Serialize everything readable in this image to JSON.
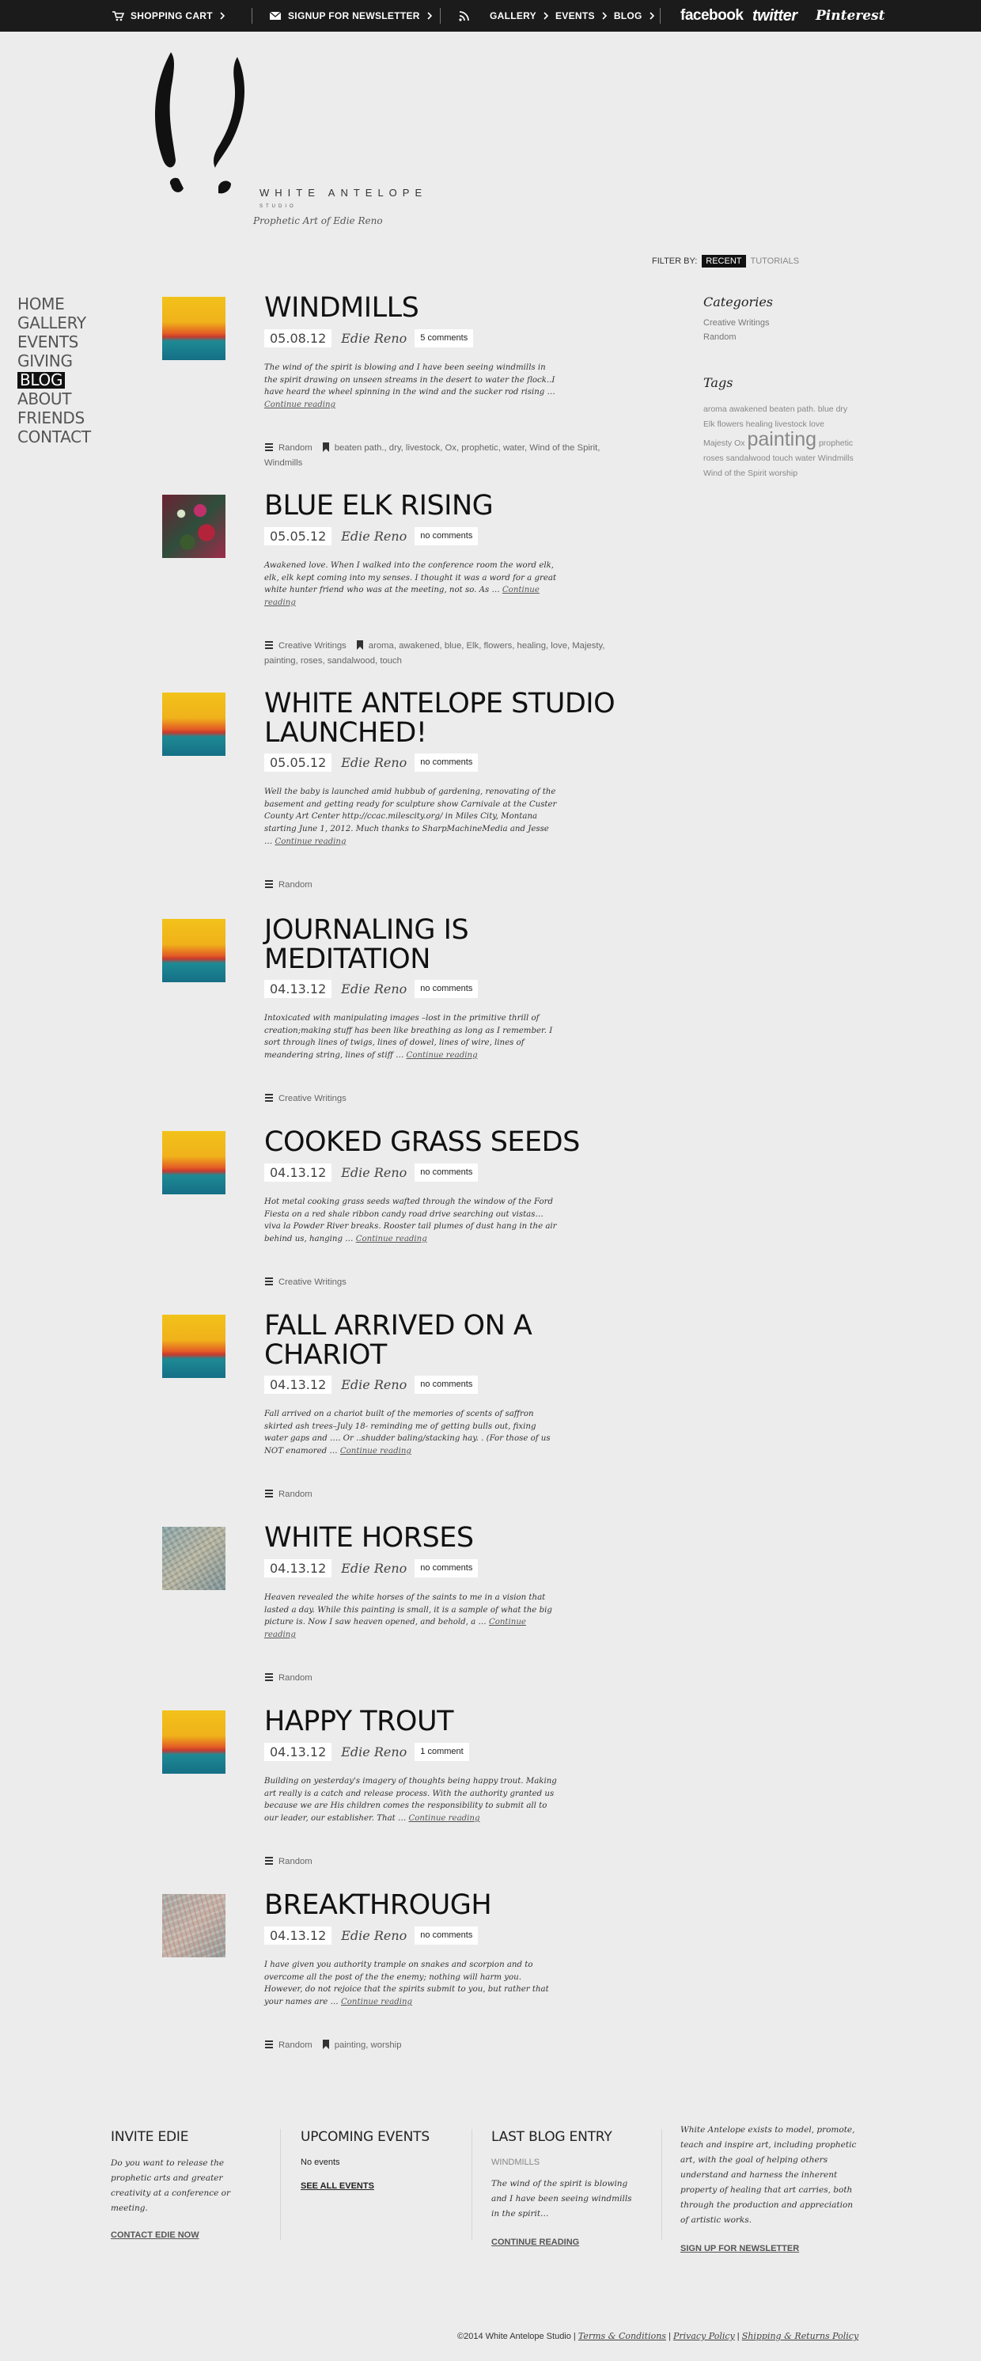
{
  "topbar": {
    "cart": "SHOPPING CART",
    "newsletter": "SIGNUP FOR NEWSLETTER",
    "gallery": "GALLERY",
    "events": "EVENTS",
    "blog": "BLOG",
    "facebook": "facebook",
    "twitter": "twitter",
    "pinterest": "Pinterest"
  },
  "logo": {
    "wordmark": "WHITE ANTELOPE",
    "studio": "STUDIO",
    "tagline": "Prophetic Art of Edie Reno"
  },
  "nav": [
    "HOME",
    "GALLERY",
    "EVENTS",
    "GIVING",
    "BLOG",
    "ABOUT",
    "FRIENDS",
    "CONTACT"
  ],
  "nav_active": "BLOG",
  "filter": {
    "label": "FILTER BY:",
    "recent": "RECENT",
    "tutorials": "TUTORIALS"
  },
  "posts": [
    {
      "title": "WINDMILLS",
      "date": "05.08.12",
      "author": "Edie Reno",
      "comments": "5 comments",
      "excerpt": "The wind of the spirit is blowing and I have been seeing windmills in the spirit drawing on unseen streams in the desert to water the flock..I have heard the wheel spinning in the wind and the sucker rod rising …",
      "continue": "Continue reading",
      "category": "Random",
      "tags": "beaten path., dry, livestock, Ox, prophetic, water, Wind of the Spirit, Windmills"
    },
    {
      "title": "BLUE ELK RISING",
      "date": "05.05.12",
      "author": "Edie Reno",
      "comments": "no comments",
      "excerpt": "Awakened love. When I walked into the conference room the word elk, elk, elk kept coming into my senses.   I thought it was a word for a great white hunter friend who was at the meeting, not so. As …",
      "continue": "Continue reading",
      "category": "Creative Writings",
      "tags": "aroma, awakened, blue, Elk, flowers, healing, love, Majesty, painting, roses, sandalwood, touch"
    },
    {
      "title": "WHITE ANTELOPE STUDIO LAUNCHED!",
      "date": "05.05.12",
      "author": "Edie Reno",
      "comments": "no comments",
      "excerpt": "Well the baby is launched amid hubbub of gardening, renovating of the basement and getting ready for  sculpture show Carnivale at the Custer County Art Center http://ccac.milescity.org/ in Miles City, Montana starting June 1, 2012. Much thanks to SharpMachineMedia and Jesse …",
      "continue": "Continue reading",
      "category": "Random",
      "tags": ""
    },
    {
      "title": "JOURNALING IS MEDITATION",
      "date": "04.13.12",
      "author": "Edie Reno",
      "comments": "no comments",
      "excerpt": "Intoxicated with manipulating images –lost in the primitive thrill of creation;making stuff has been like breathing as long as I remember. I sort through lines of twigs, lines of dowel, lines of wire, lines of meandering string, lines of stiff …",
      "continue": "Continue reading",
      "category": "Creative Writings",
      "tags": ""
    },
    {
      "title": "COOKED GRASS SEEDS",
      "date": "04.13.12",
      "author": "Edie Reno",
      "comments": "no comments",
      "excerpt": "Hot metal cooking grass seeds wafted through the window of the Ford Fiesta on a red shale ribbon candy road drive searching out vistas…viva la Powder River breaks. Rooster tail plumes of dust hang in the air behind us, hanging …",
      "continue": "Continue reading",
      "category": "Creative Writings",
      "tags": ""
    },
    {
      "title": "FALL ARRIVED ON A CHARIOT",
      "date": "04.13.12",
      "author": "Edie Reno",
      "comments": "no comments",
      "excerpt": "  Fall arrived on a chariot built of the memories of scents of saffron skirted ash trees–July 18- reminding me of getting bulls out, fixing water gaps and …. Or ..shudder baling/stacking hay. . (For those of us NOT enamored …",
      "continue": "Continue reading",
      "category": "Random",
      "tags": ""
    },
    {
      "title": "WHITE HORSES",
      "date": "04.13.12",
      "author": "Edie Reno",
      "comments": "no comments",
      "excerpt": "Heaven revealed the white horses of the saints to me in a vision that lasted a day. While this painting is small, it is a sample of what the big picture is. Now I saw heaven opened, and behold, a …",
      "continue": "Continue reading",
      "category": "Random",
      "tags": ""
    },
    {
      "title": "HAPPY TROUT",
      "date": "04.13.12",
      "author": "Edie Reno",
      "comments": "1 comment",
      "excerpt": "Building on yesterday's imagery of thoughts being happy trout. Making art really is a catch and release process. With the authority granted us because we are His children comes the responsibility to submit all to our leader, our establisher.  That …",
      "continue": "Continue reading",
      "category": "Random",
      "tags": ""
    },
    {
      "title": "BREAKTHROUGH",
      "date": "04.13.12",
      "author": "Edie Reno",
      "comments": "no comments",
      "excerpt": "I have given you authority trample on snakes and scorpion and to overcome all the post of the the enemy; nothing will harm you. However, do not rejoice that the spirits submit to you, but rather that your names are …",
      "continue": "Continue reading",
      "category": "Random",
      "tags": "painting, worship"
    }
  ],
  "sidebar": {
    "categories_title": "Categories",
    "categories": [
      "Creative Writings",
      "Random"
    ],
    "tags_title": "Tags",
    "tagcloud": [
      "aroma",
      "awakened",
      "beaten path.",
      "blue",
      "dry",
      "Elk",
      "flowers",
      "healing",
      "livestock",
      "love",
      "Majesty",
      "Ox",
      "painting",
      "prophetic",
      "roses",
      "sandalwood",
      "touch",
      "water",
      "Windmills",
      "Wind of the Spirit",
      "worship"
    ]
  },
  "footer": {
    "invite_title": "INVITE EDIE",
    "invite_body": "Do you want to release the prophetic arts and greater creativity at a conference or meeting.",
    "invite_link": "CONTACT EDIE NOW",
    "events_title": "UPCOMING EVENTS",
    "events_body": "No events",
    "events_link": "SEE ALL EVENTS",
    "blog_title": "LAST BLOG ENTRY",
    "blog_post": "WINDMILLS",
    "blog_body": "The wind of the spirit is blowing and I have been seeing windmills in the spirit…",
    "blog_link": "CONTINUE READING",
    "about_body": "White Antelope exists to model, promote, teach and inspire art, including prophetic art, with the goal of helping others understand and harness the inherent property of healing that art carries, both through the production and appreciation of artistic works.",
    "about_link": "SIGN UP FOR NEWSLETTER",
    "copyright": "©2014 White Antelope Studio",
    "terms": "Terms & Conditions",
    "privacy": "Privacy Policy",
    "shipping": "Shipping & Returns Policy"
  }
}
